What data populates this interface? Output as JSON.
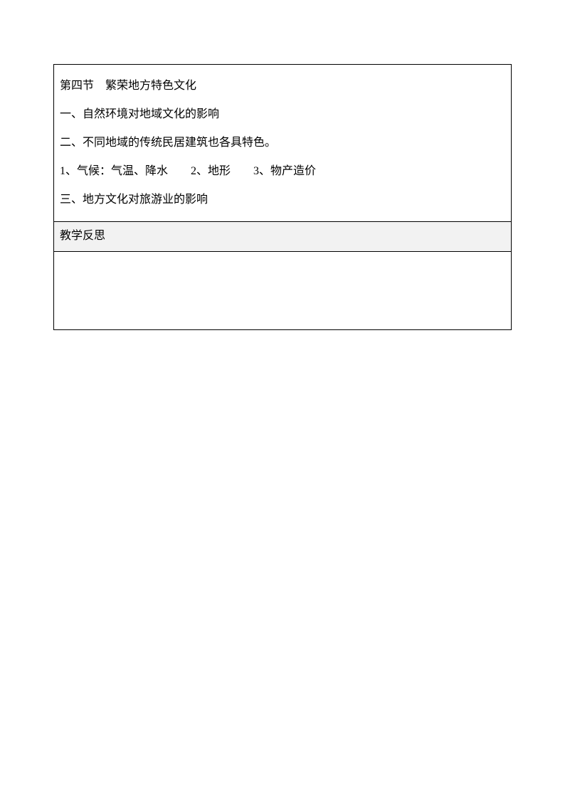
{
  "content": {
    "line1": "第四节 繁荣地方特色文化",
    "line2": "一、自然环境对地域文化的影响",
    "line3": "二、不同地域的传统民居建筑也各具特色。",
    "line4": "1、气候：气温、降水  2、地形  3、物产造价",
    "line5": "三、地方文化对旅游业的影响"
  },
  "reflection": {
    "header": "教学反思",
    "body": ""
  }
}
